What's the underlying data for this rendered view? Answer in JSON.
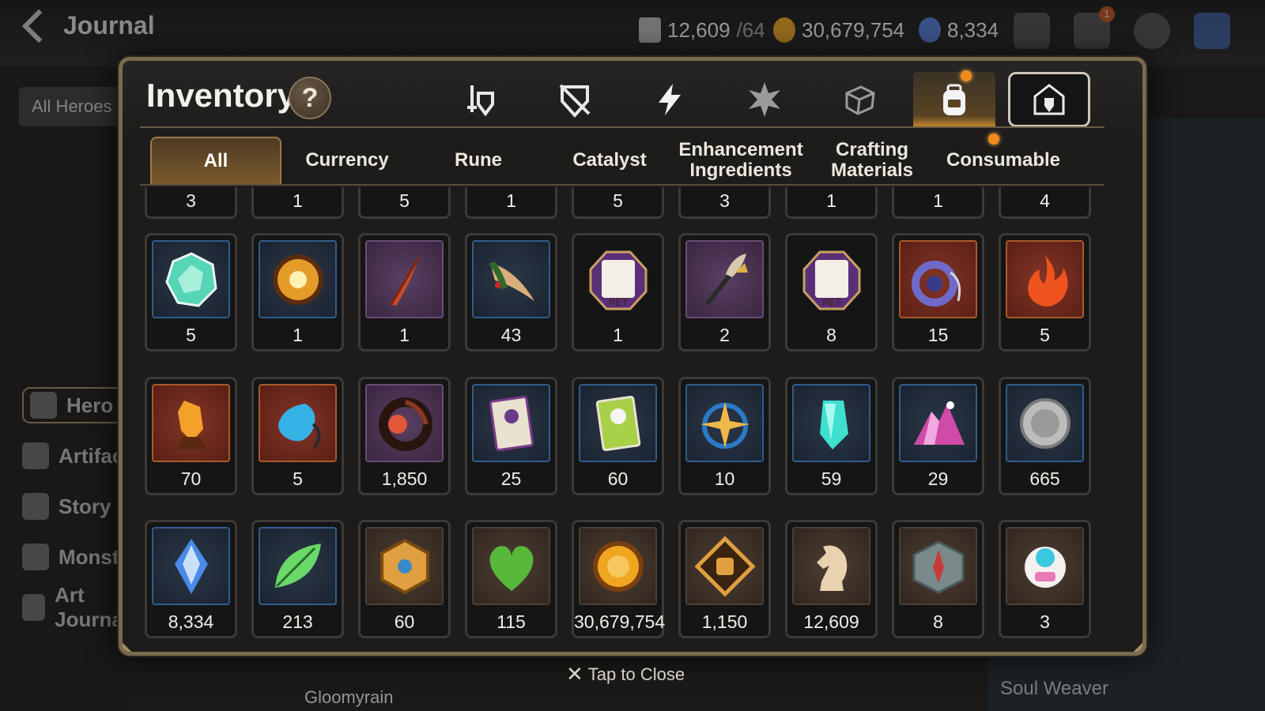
{
  "topbar": {
    "back_label": "Journal",
    "stamina": "12,609",
    "stamina_max": "/64",
    "gold": "30,679,754",
    "skystone": "8,334",
    "mail_badge": "1"
  },
  "background": {
    "filter": "All Heroes",
    "left_nav": [
      "Hero",
      "Artifact",
      "Story",
      "Monster",
      "Art Journal"
    ],
    "bottom_name": "Gloomyrain",
    "right_label": "Soul Weaver"
  },
  "modal": {
    "title": "Inventory",
    "help": "?",
    "categories": [
      {
        "icon": "equipment-icon",
        "active": false
      },
      {
        "icon": "shield-broken-icon",
        "active": false
      },
      {
        "icon": "lightning-icon",
        "active": false
      },
      {
        "icon": "spiky-star-icon",
        "active": false
      },
      {
        "icon": "cube-icon",
        "active": false
      },
      {
        "icon": "backpack-icon",
        "active": true
      },
      {
        "icon": "storage-icon",
        "active": false
      }
    ],
    "tabs": [
      {
        "label": "All",
        "active": true
      },
      {
        "label": "Currency"
      },
      {
        "label": "Rune"
      },
      {
        "label": "Catalyst"
      },
      {
        "label": "Enhancement Ingredients"
      },
      {
        "label": "Crafting Materials"
      },
      {
        "label": "Consumable",
        "dot": true
      }
    ],
    "partial_row": [
      "3",
      "1",
      "5",
      "1",
      "5",
      "3",
      "1",
      "1",
      "4"
    ],
    "rows": [
      [
        {
          "count": "5",
          "frame": "blue",
          "icon": "gem-icon",
          "color": "#56d6b6"
        },
        {
          "count": "1",
          "frame": "blue",
          "icon": "sun-medal-icon",
          "color": "#e59b2a"
        },
        {
          "count": "1",
          "frame": "purple",
          "icon": "feather-icon",
          "color": "#c64a2a"
        },
        {
          "count": "43",
          "frame": "blue",
          "icon": "root-icon",
          "color": "#d9b07a"
        },
        {
          "count": "1",
          "frame": "hex",
          "icon": "pet-food-icon",
          "color": "#5a2f78"
        },
        {
          "count": "2",
          "frame": "purple",
          "icon": "wand-icon",
          "color": "#d6c9b0"
        },
        {
          "count": "8",
          "frame": "hex",
          "icon": "pet-food-icon",
          "color": "#5a2f78"
        },
        {
          "count": "15",
          "frame": "red",
          "icon": "amulet-icon",
          "color": "#6f6ac9"
        },
        {
          "count": "5",
          "frame": "red",
          "icon": "fire-icon",
          "color": "#f0541e"
        }
      ],
      [
        {
          "count": "70",
          "frame": "red",
          "icon": "fire-crystal-icon",
          "color": "#f4a12a"
        },
        {
          "count": "5",
          "frame": "red",
          "icon": "water-drop-icon",
          "color": "#34b2e6"
        },
        {
          "count": "1,850",
          "frame": "purple",
          "icon": "flower-ring-icon",
          "color": "#e2573a"
        },
        {
          "count": "25",
          "frame": "blue",
          "icon": "card-icon",
          "color": "#e8e2d0"
        },
        {
          "count": "60",
          "frame": "blue",
          "icon": "green-card-icon",
          "color": "#a8d048"
        },
        {
          "count": "10",
          "frame": "blue",
          "icon": "star-compass-icon",
          "color": "#f0b84a"
        },
        {
          "count": "59",
          "frame": "blue",
          "icon": "teal-crystal-icon",
          "color": "#3fe0d0"
        },
        {
          "count": "29",
          "frame": "blue",
          "icon": "crystal-pile-icon",
          "color": "#d04aa8"
        },
        {
          "count": "665",
          "frame": "blue",
          "icon": "coin-icon",
          "color": "#bcbcbc"
        }
      ],
      [
        {
          "count": "8,334",
          "frame": "blue",
          "icon": "skystone-icon",
          "color": "#4a8ae8"
        },
        {
          "count": "213",
          "frame": "blue",
          "icon": "leaf-icon",
          "color": "#6bd86a"
        },
        {
          "count": "60",
          "frame": "brown",
          "icon": "emblem-icon",
          "color": "#e0a040"
        },
        {
          "count": "115",
          "frame": "brown",
          "icon": "heart-icon",
          "color": "#58b83a"
        },
        {
          "count": "30,679,754",
          "frame": "brown",
          "icon": "gold-coin-icon",
          "color": "#f0a620"
        },
        {
          "count": "1,150",
          "frame": "brown",
          "icon": "fist-badge-icon",
          "color": "#e0a040"
        },
        {
          "count": "12,609",
          "frame": "brown",
          "icon": "knight-piece-icon",
          "color": "#e8d2b0"
        },
        {
          "count": "8",
          "frame": "brown",
          "icon": "compass-icon",
          "color": "#7a8a8a"
        },
        {
          "count": "3",
          "frame": "brown",
          "icon": "robot-icon",
          "color": "#e87ab8"
        }
      ]
    ],
    "close_label": "Tap to Close"
  },
  "colors": {
    "frame_border": "#7a6a4e",
    "accent": "#f08a1c",
    "panel": "#1d1c1b"
  }
}
